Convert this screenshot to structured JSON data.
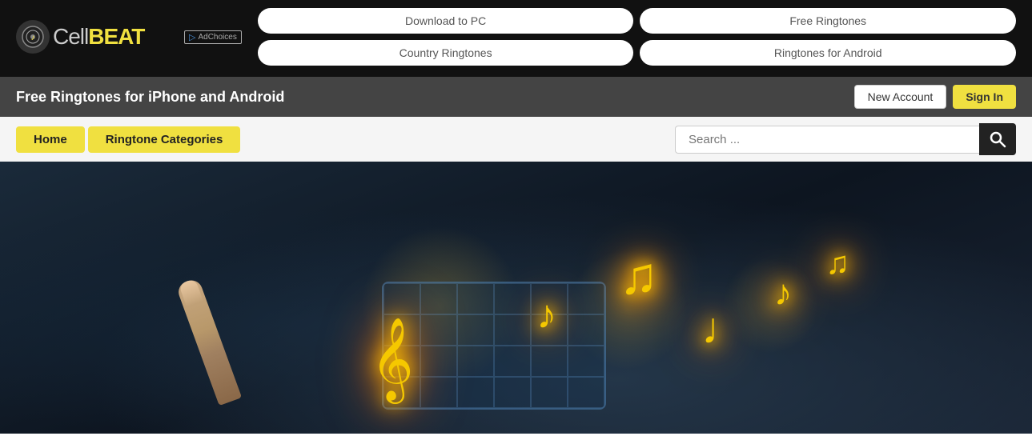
{
  "logo": {
    "cell": "Cell",
    "beat": "BEAT",
    "alt": "CellBeat Logo"
  },
  "ad": {
    "label": "AdChoices"
  },
  "nav_buttons": [
    {
      "id": "download-pc",
      "label": "Download to PC"
    },
    {
      "id": "free-ringtones",
      "label": "Free Ringtones"
    },
    {
      "id": "country-ringtones",
      "label": "Country Ringtones"
    },
    {
      "id": "ringtones-android",
      "label": "Ringtones for Android"
    }
  ],
  "middle_bar": {
    "title": "Free Ringtones for iPhone and Android",
    "new_account": "New Account",
    "sign_in": "Sign In"
  },
  "nav_bar": {
    "home": "Home",
    "categories": "Ringtone Categories",
    "search_placeholder": "Search ..."
  },
  "search_icon": "🔍",
  "hero": {
    "alt": "Phone with musical notes"
  }
}
